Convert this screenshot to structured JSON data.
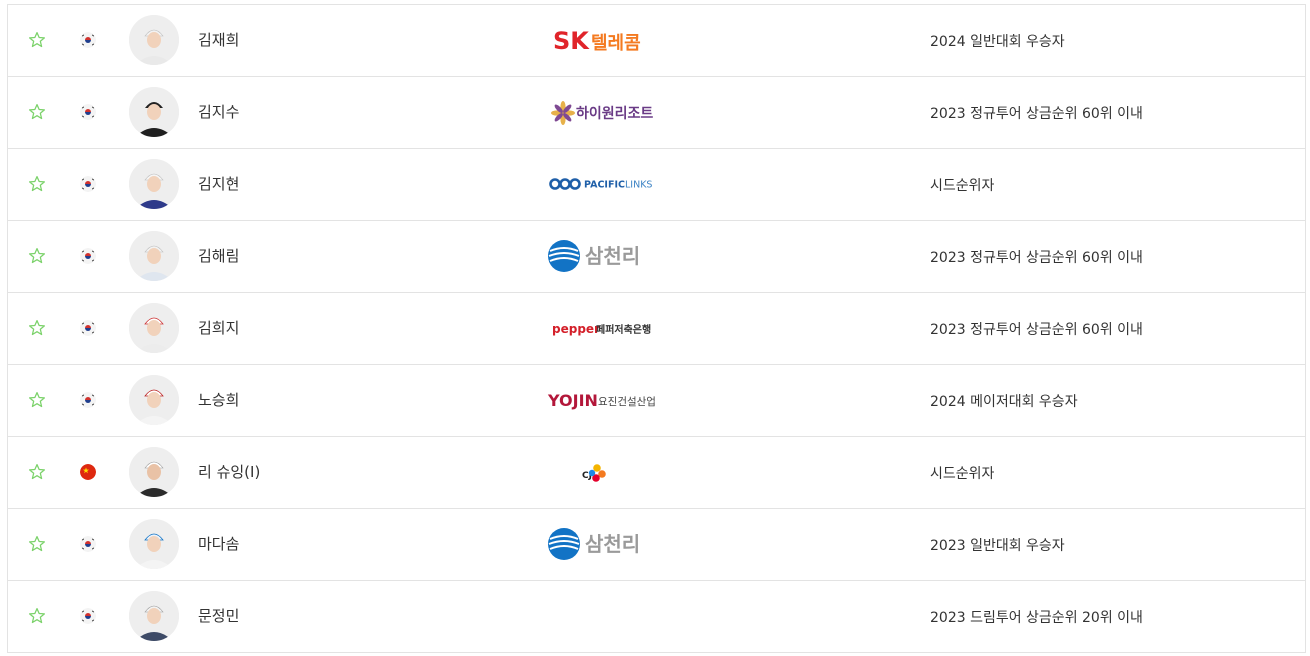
{
  "colors": {
    "star": "#7bd26a",
    "border": "#e3e3e3",
    "text": "#333333"
  },
  "players": [
    {
      "name": "김재희",
      "nationality": "KOR",
      "sponsor": "SK 텔레콤",
      "sponsor_logo": "sk-telecom",
      "qualification": "2024 일반대회 우승자"
    },
    {
      "name": "김지수",
      "nationality": "KOR",
      "sponsor": "하이원리조트",
      "sponsor_logo": "high1-resort",
      "qualification": "2023 정규투어 상금순위 60위 이내"
    },
    {
      "name": "김지현",
      "nationality": "KOR",
      "sponsor": "PACIFICLINKS",
      "sponsor_logo": "pacific-links",
      "qualification": "시드순위자"
    },
    {
      "name": "김해림",
      "nationality": "KOR",
      "sponsor": "삼천리",
      "sponsor_logo": "samchully",
      "qualification": "2023 정규투어 상금순위 60위 이내"
    },
    {
      "name": "김희지",
      "nationality": "KOR",
      "sponsor": "pepper 페퍼저축은행",
      "sponsor_logo": "pepper-savings-bank",
      "qualification": "2023 정규투어 상금순위 60위 이내"
    },
    {
      "name": "노승희",
      "nationality": "KOR",
      "sponsor": "YOJIN 요진건설산업",
      "sponsor_logo": "yojin",
      "qualification": "2024 메이저대회 우승자"
    },
    {
      "name": "리 슈잉(I)",
      "nationality": "CHN",
      "sponsor": "CJ",
      "sponsor_logo": "cj",
      "qualification": "시드순위자"
    },
    {
      "name": "마다솜",
      "nationality": "KOR",
      "sponsor": "삼천리",
      "sponsor_logo": "samchully",
      "qualification": "2023 일반대회 우승자"
    },
    {
      "name": "문정민",
      "nationality": "KOR",
      "sponsor": "",
      "sponsor_logo": "",
      "qualification": "2023 드림투어 상금순위 20위 이내"
    }
  ]
}
